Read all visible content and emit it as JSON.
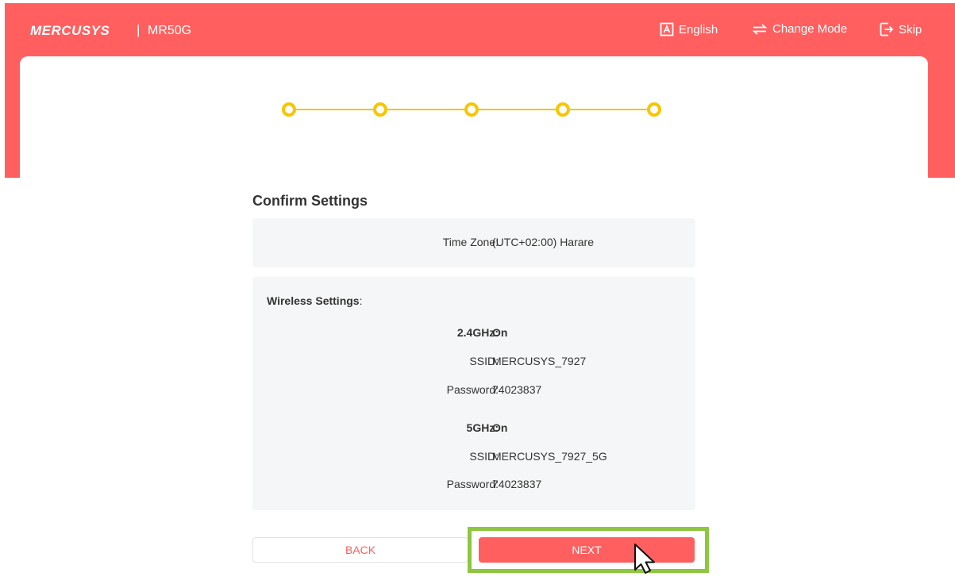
{
  "header": {
    "brand": "MERCUSYS",
    "separator": "|",
    "model": "MR50G",
    "language_label": "English",
    "change_mode_label": "Change Mode",
    "skip_label": "Skip"
  },
  "stepper": {
    "total_steps": 5,
    "current_step": 5
  },
  "confirm": {
    "title": "Confirm Settings",
    "time_zone": {
      "label": "Time Zone:",
      "value": "(UTC+02:00) Harare"
    },
    "wireless": {
      "title": "Wireless Settings",
      "title_colon": ":",
      "band_24": {
        "label": "2.4GHz:",
        "value": "On",
        "ssid_label": "SSID:",
        "ssid": "MERCUSYS_7927",
        "password_label": "Password:",
        "password": "74023837"
      },
      "band_5": {
        "label": "5GHz:",
        "value": "On",
        "ssid_label": "SSID:",
        "ssid": "MERCUSYS_7927_5G",
        "password_label": "Password:",
        "password": "74023837"
      }
    }
  },
  "buttons": {
    "back_label": "BACK",
    "next_label": "NEXT"
  },
  "colors": {
    "brand": "#ff5f5f",
    "step": "#f7c600",
    "highlight": "#8dc63f",
    "panel": "#f5f6f7"
  },
  "icons": {
    "language": "letter-a-box-icon",
    "change_mode": "swap-arrows-icon",
    "skip": "exit-arrow-icon"
  }
}
